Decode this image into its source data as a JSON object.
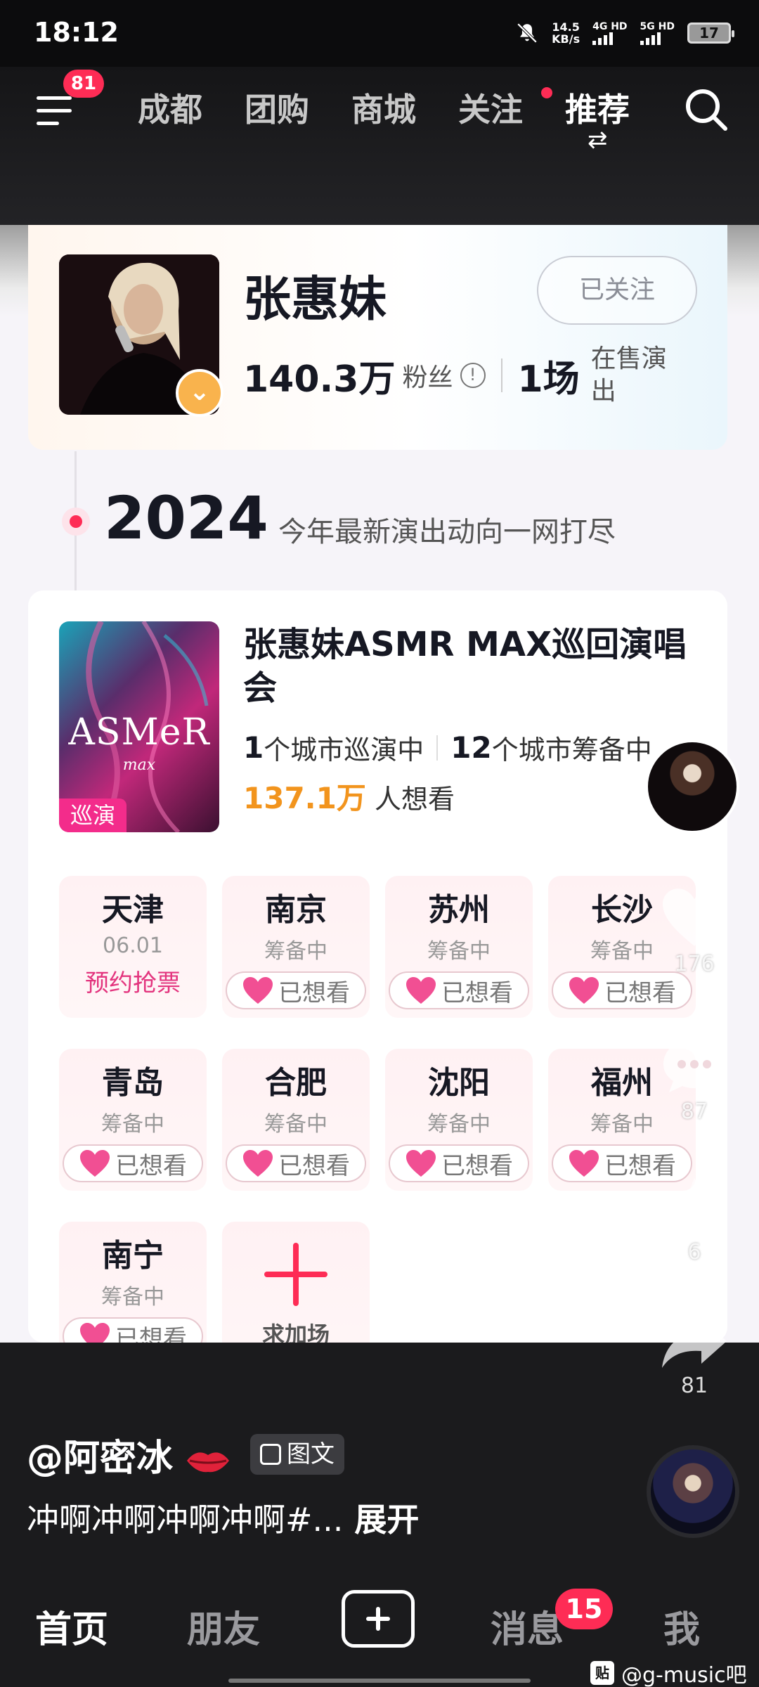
{
  "status_bar": {
    "time": "18:12",
    "net_speed": "14.5",
    "net_unit": "KB/s",
    "sim1": "4G HD",
    "sim2": "5G HD",
    "battery": "17"
  },
  "top_nav": {
    "menu_badge": "81",
    "tabs": [
      {
        "label": "成都",
        "active": false
      },
      {
        "label": "团购",
        "active": false
      },
      {
        "label": "商城",
        "active": false
      },
      {
        "label": "关注",
        "active": false,
        "dot": true
      },
      {
        "label": "推荐",
        "active": true
      }
    ],
    "swap_glyph": "⇄"
  },
  "artist": {
    "name": "张惠妹",
    "follow_label": "已关注",
    "fans_count": "140.3万",
    "fans_label": "粉丝",
    "info_glyph": "!",
    "shows_count": "1场",
    "shows_label": "在售演出",
    "verify_glyph": "⌄"
  },
  "timeline": {
    "year": "2024",
    "year_desc": "今年最新演出动向一网打尽"
  },
  "tour": {
    "title": "张惠妹ASMR MAX巡回演唱会",
    "poster_title": "ASMeR",
    "poster_sub": "max",
    "poster_tag": "巡演",
    "touring_count": "1",
    "touring_label": "个城市巡演中",
    "preparing_count": "12",
    "preparing_label": "个城市筹备中",
    "want_count": "137.1万",
    "want_label": "人想看",
    "cities": [
      {
        "name": "天津",
        "status": "06.01",
        "action": "预约抢票",
        "type": "booking"
      },
      {
        "name": "南京",
        "status": "筹备中",
        "action": "已想看",
        "type": "want"
      },
      {
        "name": "苏州",
        "status": "筹备中",
        "action": "已想看",
        "type": "want"
      },
      {
        "name": "长沙",
        "status": "筹备中",
        "action": "已想看",
        "type": "want"
      },
      {
        "name": "青岛",
        "status": "筹备中",
        "action": "已想看",
        "type": "want"
      },
      {
        "name": "合肥",
        "status": "筹备中",
        "action": "已想看",
        "type": "want"
      },
      {
        "name": "沈阳",
        "status": "筹备中",
        "action": "已想看",
        "type": "want"
      },
      {
        "name": "福州",
        "status": "筹备中",
        "action": "已想看",
        "type": "want"
      },
      {
        "name": "南宁",
        "status": "筹备中",
        "action": "已想看",
        "type": "want"
      }
    ],
    "add_show_label": "求加场"
  },
  "side_actions": {
    "likes": "176",
    "comments": "87",
    "favorites": "6",
    "shares": "81"
  },
  "caption": {
    "author": "@阿密冰",
    "tag": "图文",
    "description": "冲啊冲啊冲啊冲啊#...",
    "expand": "展开"
  },
  "tab_bar": {
    "tabs": [
      "首页",
      "朋友",
      "消息",
      "我"
    ],
    "active": "首页",
    "msg_badge": "15",
    "watermark_logo": "贴",
    "watermark": "@g-music吧"
  }
}
